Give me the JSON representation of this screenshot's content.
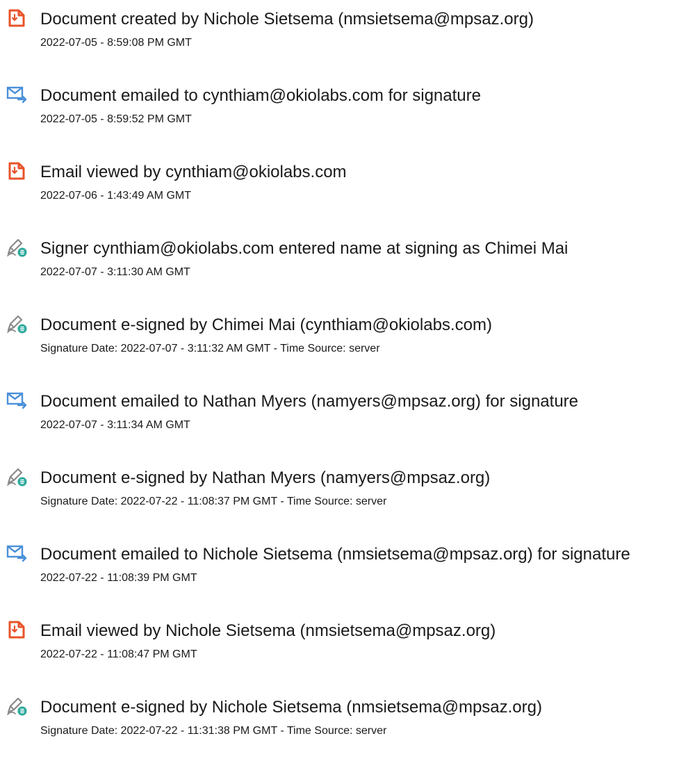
{
  "events": [
    {
      "icon": "document-created-icon",
      "title": "Document created by Nichole Sietsema (nmsietsema@mpsaz.org)",
      "time": "2022-07-05 - 8:59:08 PM GMT"
    },
    {
      "icon": "email-sent-icon",
      "title": "Document emailed to cynthiam@okiolabs.com for signature",
      "time": "2022-07-05 - 8:59:52 PM GMT"
    },
    {
      "icon": "document-viewed-icon",
      "title": "Email viewed by cynthiam@okiolabs.com",
      "time": "2022-07-06 - 1:43:49 AM GMT"
    },
    {
      "icon": "e-sign-icon",
      "title": "Signer cynthiam@okiolabs.com entered name at signing as Chimei Mai",
      "time": "2022-07-07 - 3:11:30 AM GMT"
    },
    {
      "icon": "e-sign-icon",
      "title": "Document e-signed by Chimei Mai (cynthiam@okiolabs.com)",
      "time": "Signature Date: 2022-07-07 - 3:11:32 AM GMT - Time Source: server"
    },
    {
      "icon": "email-sent-icon",
      "title": "Document emailed to Nathan Myers (namyers@mpsaz.org) for signature",
      "time": "2022-07-07 - 3:11:34 AM GMT"
    },
    {
      "icon": "e-sign-icon",
      "title": "Document e-signed by Nathan Myers (namyers@mpsaz.org)",
      "time": "Signature Date: 2022-07-22 - 11:08:37 PM GMT - Time Source: server"
    },
    {
      "icon": "email-sent-icon",
      "title": "Document emailed to Nichole Sietsema (nmsietsema@mpsaz.org) for signature",
      "time": "2022-07-22 - 11:08:39 PM GMT"
    },
    {
      "icon": "document-viewed-icon",
      "title": "Email viewed by Nichole Sietsema (nmsietsema@mpsaz.org)",
      "time": "2022-07-22 - 11:08:47 PM GMT"
    },
    {
      "icon": "e-sign-icon",
      "title": "Document e-signed by Nichole Sietsema (nmsietsema@mpsaz.org)",
      "time": "Signature Date: 2022-07-22 - 11:31:38 PM GMT - Time Source: server"
    }
  ],
  "colors": {
    "document_icon": "#e8532a",
    "email_icon": "#4a90d9",
    "sign_icon_pen": "#8a8a8a",
    "sign_icon_badge": "#2ba89a",
    "text": "#1a1a1a"
  }
}
